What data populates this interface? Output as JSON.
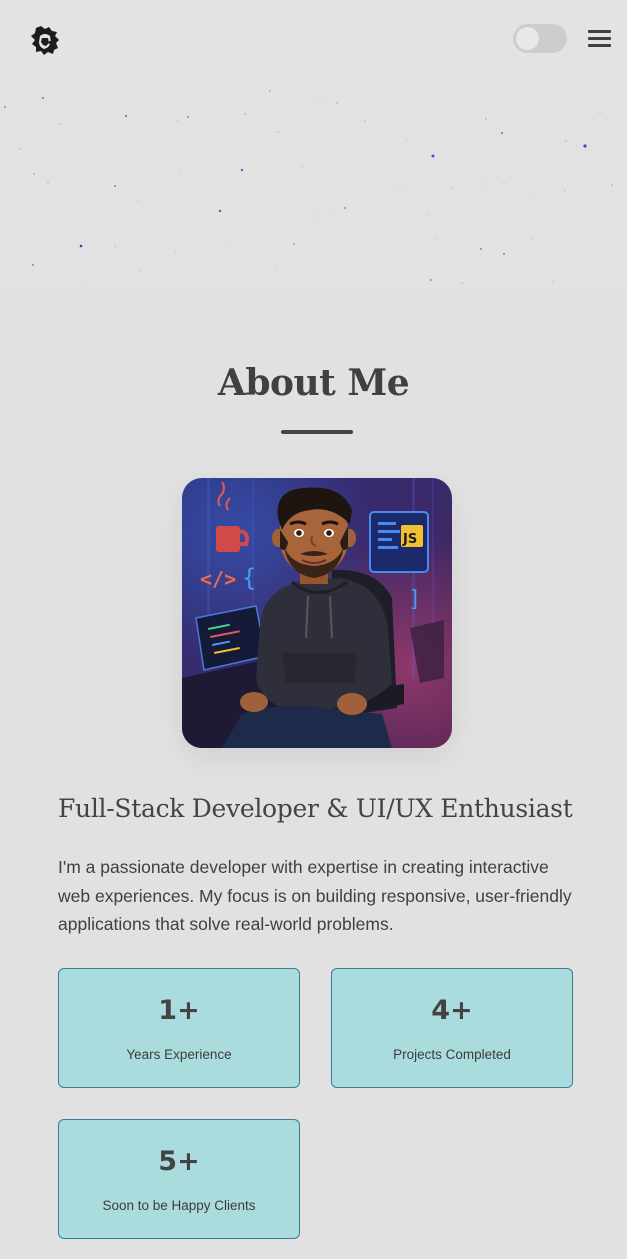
{
  "header": {
    "logo_icon": "lion-logo-icon",
    "theme_toggle_state": "off",
    "menu_icon": "hamburger-menu-icon"
  },
  "about": {
    "title": "About Me",
    "avatar_icon": "developer-avatar-illustration",
    "avatar_badge": "JS",
    "subtitle": "Full-Stack Developer & UI/UX Enthusiast",
    "bio": "I'm a passionate developer with expertise in creating interactive web experiences. My focus is on building responsive, user-friendly applications that solve real-world problems.",
    "stats": [
      {
        "value": "1+",
        "label": "Years Experience"
      },
      {
        "value": "4+",
        "label": "Projects Completed"
      },
      {
        "value": "5+",
        "label": "Soon to be Happy Clients"
      }
    ]
  },
  "colors": {
    "background": "#e1e1e1",
    "stat_card_bg": "#abdcdd",
    "stat_card_border": "#3a7d94",
    "text": "#444444"
  }
}
